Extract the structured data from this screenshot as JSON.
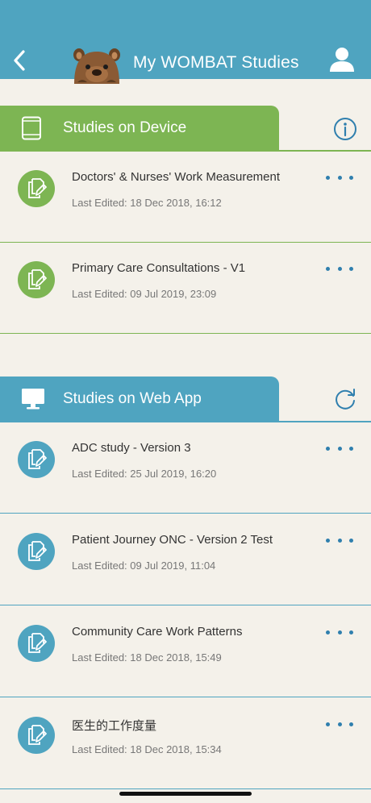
{
  "header": {
    "title": "My WOMBAT Studies",
    "back_icon": "chevron-left-icon",
    "profile_icon": "user-icon",
    "bg_color": "#4fa4c0"
  },
  "device_section": {
    "label": "Studies on Device",
    "icon": "tablet-icon",
    "action_icon": "info-icon",
    "color": "#7db553",
    "items": [
      {
        "name": "Doctors' & Nurses' Work Measurement",
        "last_edited": "Last Edited: 18 Dec 2018, 16:12"
      },
      {
        "name": "Primary Care Consultations - V1",
        "last_edited": "Last Edited: 09 Jul 2019, 23:09"
      }
    ]
  },
  "web_section": {
    "label": "Studies on Web App",
    "icon": "monitor-icon",
    "action_icon": "refresh-icon",
    "color": "#4fa4c0",
    "items": [
      {
        "name": "ADC study - Version 3",
        "last_edited": "Last Edited: 25 Jul 2019, 16:20"
      },
      {
        "name": "Patient Journey ONC - Version 2 Test",
        "last_edited": "Last Edited: 09 Jul 2019, 11:04"
      },
      {
        "name": "Community Care Work Patterns",
        "last_edited": "Last Edited: 18 Dec 2018, 15:49"
      },
      {
        "name": "医生的工作度量",
        "last_edited": "Last Edited: 18 Dec 2018, 15:34"
      }
    ]
  }
}
